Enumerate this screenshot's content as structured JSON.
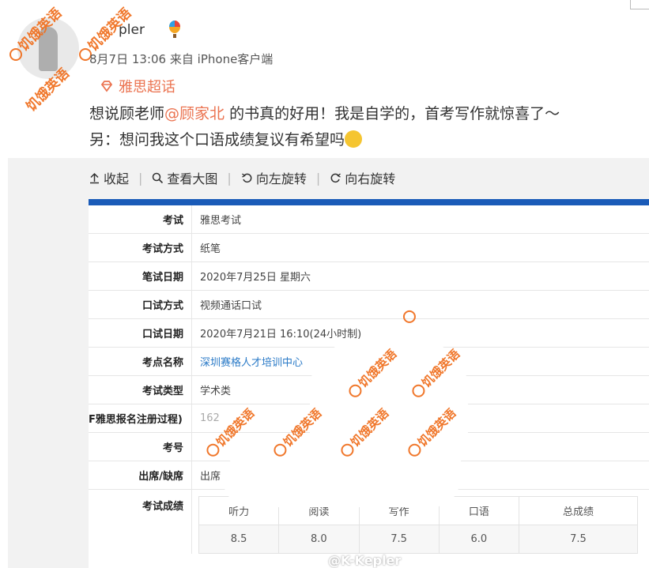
{
  "post": {
    "username": "K-Kepler",
    "username_visible": "pler",
    "timestamp": "8月7日 13:06",
    "source_prefix": "来自",
    "source": "iPhone客户端",
    "topic": "雅思超话",
    "text_line1_a": "想说顾老师",
    "mention": "@顾家北",
    "text_line1_b": " 的书真的好用！我是自学的，首考写作就惊喜了～",
    "text_line2": "另：想问我这个口语成绩复议有希望吗"
  },
  "toolbar": {
    "collapse": "收起",
    "view_large": "查看大图",
    "rotate_left": "向左旋转",
    "rotate_right": "向右旋转"
  },
  "result": {
    "rows": [
      {
        "label": "考试",
        "value": "雅思考试"
      },
      {
        "label": "考试方式",
        "value": "纸笔"
      },
      {
        "label": "笔试日期",
        "value": "2020年7月25日 星期六"
      },
      {
        "label": "口试方式",
        "value": "视频通话口试"
      },
      {
        "label": "口试日期",
        "value": "2020年7月21日 16:10(24小时制)"
      },
      {
        "label": "考点名称",
        "value": "深圳赛格人才培训中心"
      },
      {
        "label": "考试类型",
        "value": "学术类"
      },
      {
        "label": "F雅思报名注册过程)",
        "value": "162"
      },
      {
        "label": "考号",
        "value": ""
      },
      {
        "label": "出席/缺席",
        "value": "出席"
      }
    ],
    "scores_label": "考试成绩",
    "score_headers": [
      "听力",
      "阅读",
      "写作",
      "口语",
      "总成绩"
    ],
    "score_values": [
      "8.5",
      "8.0",
      "7.5",
      "6.0",
      "7.5"
    ]
  },
  "watermark": {
    "text": "饥饿英语"
  },
  "credit": "@K-Kepler",
  "colors": {
    "accent": "#eb7350",
    "link": "#2a7ac7",
    "header_bar": "#1a5bb8",
    "watermark": "#f07020"
  }
}
